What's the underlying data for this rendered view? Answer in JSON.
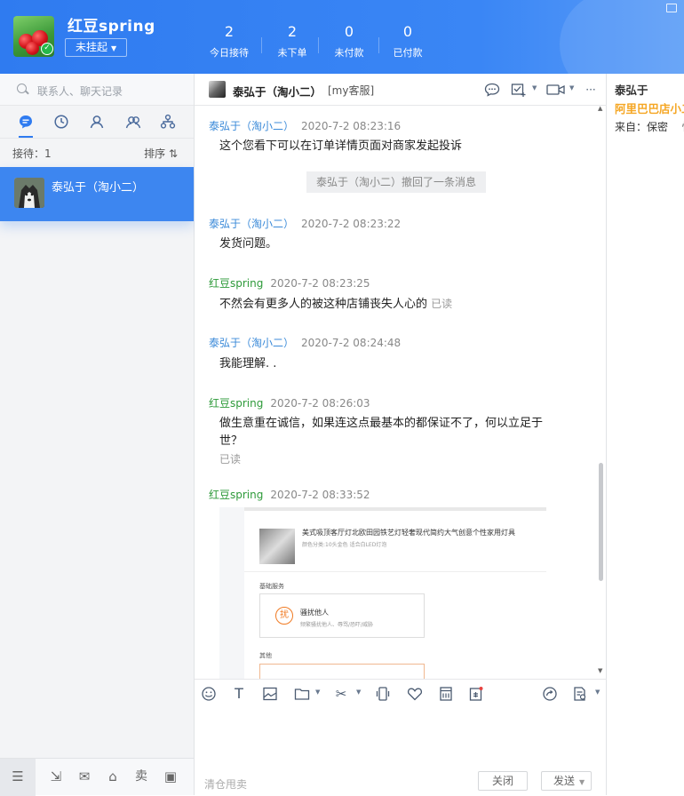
{
  "header": {
    "username": "红豆spring",
    "status": "未挂起",
    "stats": [
      {
        "value": "2",
        "label": "今日接待"
      },
      {
        "value": "2",
        "label": "未下单"
      },
      {
        "value": "0",
        "label": "未付款"
      },
      {
        "value": "0",
        "label": "已付款"
      }
    ]
  },
  "sidebar": {
    "search_placeholder": "联系人、聊天记录",
    "queue_label": "接待：1",
    "sort_label": "排序 ⇅",
    "contacts": [
      {
        "name": "泰弘于（淘小二）"
      }
    ]
  },
  "chat": {
    "title": "泰弘于（淘小二）",
    "tag": "[my客服]",
    "messages": [
      {
        "sender": "泰弘于（淘小二）",
        "time": "2020-7-2 08:23:16",
        "text": "这个您看下可以在订单详情页面对商家发起投诉"
      },
      {
        "sender": "泰弘于（淘小二）",
        "time": "2020-7-2 08:23:22",
        "text": "发货问题。"
      },
      {
        "sender": "红豆spring",
        "time": "2020-7-2 08:23:25",
        "text": "不然会有更多人的被这种店铺丧失人心的",
        "status": "已读"
      },
      {
        "sender": "泰弘于（淘小二）",
        "time": "2020-7-2 08:24:48",
        "text": "我能理解. ."
      },
      {
        "sender": "红豆spring",
        "time": "2020-7-2 08:26:03",
        "text": "做生意重在诚信，如果连这点最基本的都保证不了，何以立足于世？",
        "status": "已读"
      },
      {
        "sender": "红豆spring",
        "time": "2020-7-2 08:33:52"
      }
    ],
    "recall_notice": "泰弘于（淘小二）撤回了一条消息",
    "screenshot": {
      "product_title": "美式吸顶客厅灯北欧田园铁艺灯轻奢现代简约大气创意个性家用灯具",
      "product_sub": "颜色分类:10头金色 适合白LED灯泡",
      "section1": "基础服务",
      "service_badge": "扰",
      "service_title": "骚扰他人",
      "service_desc": "频繁骚扰他人、辱骂/恐吓/威胁",
      "section2": "其他"
    }
  },
  "input": {
    "placeholder": "清仓甩卖",
    "close_label": "关闭",
    "send_label": "发送"
  },
  "right_panel": {
    "name": "泰弘于",
    "shop": "阿里巴巴店小二",
    "from_label": "来自：保密",
    "from_extra": "性"
  }
}
